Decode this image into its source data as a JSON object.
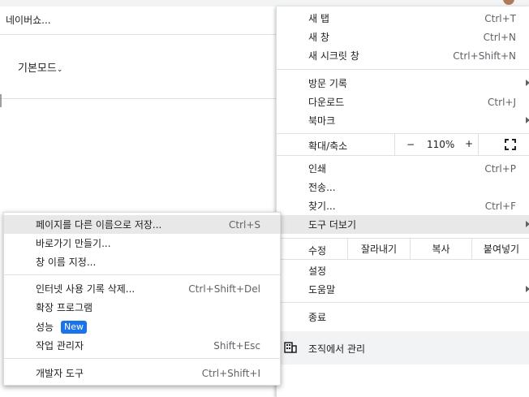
{
  "background": {
    "tab_title": "네이버쇼...",
    "mode_label": "기본모드",
    "mode_chevron": "chevron-down-icon"
  },
  "menu": {
    "new_tab": {
      "label": "새 탭",
      "shortcut": "Ctrl+T"
    },
    "new_window": {
      "label": "새 창",
      "shortcut": "Ctrl+N"
    },
    "incognito": {
      "label": "새 시크릿 창",
      "shortcut": "Ctrl+Shift+N"
    },
    "history": {
      "label": "방문 기록"
    },
    "downloads": {
      "label": "다운로드",
      "shortcut": "Ctrl+J"
    },
    "bookmarks": {
      "label": "북마크"
    },
    "zoom": {
      "label": "확대/축소",
      "minus": "−",
      "value": "110%",
      "plus": "+"
    },
    "print": {
      "label": "인쇄",
      "shortcut": "Ctrl+P"
    },
    "cast": {
      "label": "전송..."
    },
    "find": {
      "label": "찾기...",
      "shortcut": "Ctrl+F"
    },
    "more_tools": {
      "label": "도구 더보기"
    },
    "edit": {
      "label": "수정",
      "cut": "잘라내기",
      "copy": "복사",
      "paste": "붙여넣기"
    },
    "settings": {
      "label": "설정"
    },
    "help": {
      "label": "도움말"
    },
    "exit": {
      "label": "종료"
    },
    "managed": {
      "label": "조직에서 관리"
    }
  },
  "submenu": {
    "save_page": {
      "label": "페이지를 다른 이름으로 저장...",
      "shortcut": "Ctrl+S"
    },
    "create_shortcut": {
      "label": "바로가기 만들기..."
    },
    "name_window": {
      "label": "창 이름 지정..."
    },
    "clear_data": {
      "label": "인터넷 사용 기록 삭제...",
      "shortcut": "Ctrl+Shift+Del"
    },
    "extensions": {
      "label": "확장 프로그램"
    },
    "performance": {
      "label": "성능",
      "badge": "New"
    },
    "task_manager": {
      "label": "작업 관리자",
      "shortcut": "Shift+Esc"
    },
    "dev_tools": {
      "label": "개발자 도구",
      "shortcut": "Ctrl+Shift+I"
    }
  },
  "colors": {
    "highlight": "#e8e8e8",
    "badge": "#1a73e8"
  }
}
